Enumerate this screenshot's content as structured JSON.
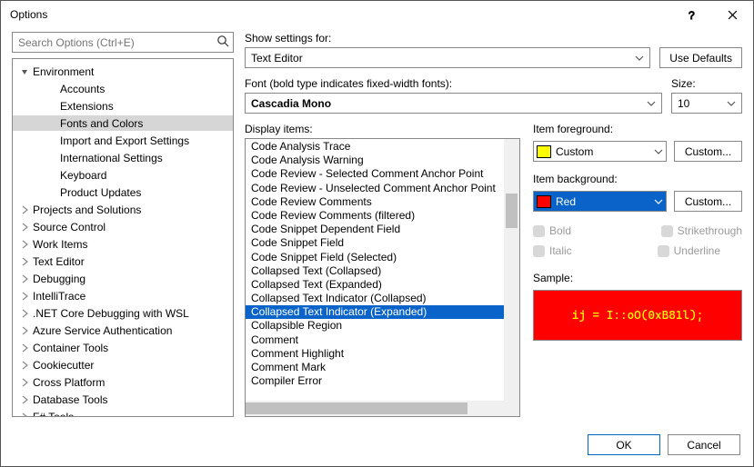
{
  "window": {
    "title": "Options"
  },
  "search": {
    "placeholder": "Search Options (Ctrl+E)"
  },
  "tree": [
    {
      "label": "Environment",
      "depth": 0,
      "exp": "open"
    },
    {
      "label": "Accounts",
      "depth": 1,
      "exp": "none"
    },
    {
      "label": "Extensions",
      "depth": 1,
      "exp": "none"
    },
    {
      "label": "Fonts and Colors",
      "depth": 1,
      "exp": "none",
      "selected": true
    },
    {
      "label": "Import and Export Settings",
      "depth": 1,
      "exp": "none"
    },
    {
      "label": "International Settings",
      "depth": 1,
      "exp": "none"
    },
    {
      "label": "Keyboard",
      "depth": 1,
      "exp": "none"
    },
    {
      "label": "Product Updates",
      "depth": 1,
      "exp": "none"
    },
    {
      "label": "Projects and Solutions",
      "depth": 0,
      "exp": "closed"
    },
    {
      "label": "Source Control",
      "depth": 0,
      "exp": "closed"
    },
    {
      "label": "Work Items",
      "depth": 0,
      "exp": "closed"
    },
    {
      "label": "Text Editor",
      "depth": 0,
      "exp": "closed"
    },
    {
      "label": "Debugging",
      "depth": 0,
      "exp": "closed"
    },
    {
      "label": "IntelliTrace",
      "depth": 0,
      "exp": "closed"
    },
    {
      "label": ".NET Core Debugging with WSL",
      "depth": 0,
      "exp": "closed"
    },
    {
      "label": "Azure Service Authentication",
      "depth": 0,
      "exp": "closed"
    },
    {
      "label": "Container Tools",
      "depth": 0,
      "exp": "closed"
    },
    {
      "label": "Cookiecutter",
      "depth": 0,
      "exp": "closed"
    },
    {
      "label": "Cross Platform",
      "depth": 0,
      "exp": "closed"
    },
    {
      "label": "Database Tools",
      "depth": 0,
      "exp": "closed"
    },
    {
      "label": "F# Tools",
      "depth": 0,
      "exp": "closed"
    }
  ],
  "settings": {
    "show_label": "Show settings for:",
    "show_value": "Text Editor",
    "use_defaults": "Use Defaults",
    "font_label": "Font (bold type indicates fixed-width fonts):",
    "font_value": "Cascadia Mono",
    "size_label": "Size:",
    "size_value": "10",
    "display_label": "Display items:"
  },
  "items": [
    "Code Analysis Trace",
    "Code Analysis Warning",
    "Code Review - Selected Comment Anchor Point",
    "Code Review - Unselected Comment Anchor Point",
    "Code Review Comments",
    "Code Review Comments (filtered)",
    "Code Snippet Dependent Field",
    "Code Snippet Field",
    "Code Snippet Field (Selected)",
    "Collapsed Text (Collapsed)",
    "Collapsed Text (Expanded)",
    "Collapsed Text Indicator (Collapsed)",
    "Collapsed Text Indicator (Expanded)",
    "Collapsible Region",
    "Comment",
    "Comment Highlight",
    "Comment Mark",
    "Compiler Error"
  ],
  "items_selected_index": 12,
  "props": {
    "fg_label": "Item foreground:",
    "fg_value": "Custom",
    "fg_swatch": "#ffff00",
    "bg_label": "Item background:",
    "bg_value": "Red",
    "bg_swatch": "#ff0000",
    "custom_btn": "Custom...",
    "bold": "Bold",
    "italic": "Italic",
    "strike": "Strikethrough",
    "underline": "Underline",
    "sample_label": "Sample:",
    "sample_text": "ij = I::oO(0xB81l);"
  },
  "footer": {
    "ok": "OK",
    "cancel": "Cancel"
  }
}
